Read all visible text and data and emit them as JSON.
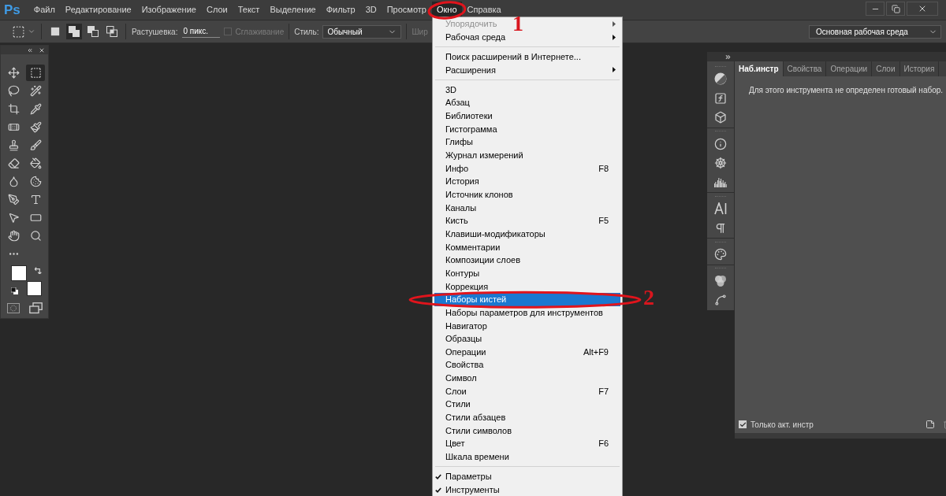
{
  "menu_bar": {
    "logo": "Ps",
    "items": [
      {
        "label": "Файл",
        "selected": false
      },
      {
        "label": "Редактирование",
        "selected": false
      },
      {
        "label": "Изображение",
        "selected": false
      },
      {
        "label": "Слои",
        "selected": false
      },
      {
        "label": "Текст",
        "selected": false
      },
      {
        "label": "Выделение",
        "selected": false
      },
      {
        "label": "Фильтр",
        "selected": false
      },
      {
        "label": "3D",
        "selected": false
      },
      {
        "label": "Просмотр",
        "selected": false
      },
      {
        "label": "Окно",
        "selected": true
      },
      {
        "label": "Справка",
        "selected": false
      }
    ]
  },
  "options_bar": {
    "selection_modes": [
      {
        "kind": "new",
        "selected": false
      },
      {
        "kind": "add",
        "selected": true
      },
      {
        "kind": "subtract",
        "selected": false
      },
      {
        "kind": "intersect",
        "selected": false
      }
    ],
    "feather": {
      "label": "Растушевка:",
      "value": "0 пикс."
    },
    "anti_alias": {
      "label": "Сглаживание",
      "checked": false,
      "disabled": true
    },
    "style": {
      "label": "Стиль:",
      "value": "Обычный"
    },
    "width": {
      "label": "Шир",
      "disabled": true
    },
    "workspace": {
      "value": "Основная рабочая среда"
    }
  },
  "toolbar": {
    "tools": [
      {
        "kind": "move",
        "selected": false
      },
      {
        "kind": "marquee",
        "selected": true
      },
      {
        "kind": "lasso",
        "selected": false
      },
      {
        "kind": "wand",
        "selected": false
      },
      {
        "kind": "crop",
        "selected": false
      },
      {
        "kind": "eyedropper",
        "selected": false
      },
      {
        "kind": "healing",
        "selected": false
      },
      {
        "kind": "brush",
        "selected": false
      },
      {
        "kind": "stamp",
        "selected": false
      },
      {
        "kind": "history_brush",
        "selected": false
      },
      {
        "kind": "eraser",
        "selected": false
      },
      {
        "kind": "bucket",
        "selected": false
      },
      {
        "kind": "blur",
        "selected": false
      },
      {
        "kind": "sponge",
        "selected": false
      },
      {
        "kind": "pen",
        "selected": false
      },
      {
        "kind": "type",
        "selected": false
      },
      {
        "kind": "path_select",
        "selected": false
      },
      {
        "kind": "shape",
        "selected": false
      },
      {
        "kind": "hand",
        "selected": false
      },
      {
        "kind": "zoom",
        "selected": false
      },
      {
        "kind": "more",
        "selected": false
      }
    ]
  },
  "window_menu": {
    "items": [
      {
        "kind": "submenu",
        "label": "Упорядочить",
        "disabled": true,
        "checked": false,
        "selected": false
      },
      {
        "kind": "submenu",
        "label": "Рабочая среда",
        "disabled": false,
        "checked": false,
        "selected": false
      },
      {
        "kind": "separator"
      },
      {
        "kind": "item",
        "label": "Поиск расширений в Интернете...",
        "disabled": false,
        "checked": false,
        "selected": false
      },
      {
        "kind": "submenu",
        "label": "Расширения",
        "disabled": false,
        "checked": false,
        "selected": false
      },
      {
        "kind": "separator"
      },
      {
        "kind": "item",
        "label": "3D",
        "disabled": false,
        "checked": false,
        "selected": false
      },
      {
        "kind": "item",
        "label": "Абзац",
        "disabled": false,
        "checked": false,
        "selected": false
      },
      {
        "kind": "item",
        "label": "Библиотеки",
        "disabled": false,
        "checked": false,
        "selected": false
      },
      {
        "kind": "item",
        "label": "Гистограмма",
        "disabled": false,
        "checked": false,
        "selected": false
      },
      {
        "kind": "item",
        "label": "Глифы",
        "disabled": false,
        "checked": false,
        "selected": false
      },
      {
        "kind": "item",
        "label": "Журнал измерений",
        "disabled": false,
        "checked": false,
        "selected": false
      },
      {
        "kind": "item",
        "label": "Инфо",
        "shortcut": "F8",
        "disabled": false,
        "checked": false,
        "selected": false
      },
      {
        "kind": "item",
        "label": "История",
        "disabled": false,
        "checked": false,
        "selected": false
      },
      {
        "kind": "item",
        "label": "Источник клонов",
        "disabled": false,
        "checked": false,
        "selected": false
      },
      {
        "kind": "item",
        "label": "Каналы",
        "disabled": false,
        "checked": false,
        "selected": false
      },
      {
        "kind": "item",
        "label": "Кисть",
        "shortcut": "F5",
        "disabled": false,
        "checked": false,
        "selected": false
      },
      {
        "kind": "item",
        "label": "Клавиши-модификаторы",
        "disabled": false,
        "checked": false,
        "selected": false
      },
      {
        "kind": "item",
        "label": "Комментарии",
        "disabled": false,
        "checked": false,
        "selected": false
      },
      {
        "kind": "item",
        "label": "Композиции слоев",
        "disabled": false,
        "checked": false,
        "selected": false
      },
      {
        "kind": "item",
        "label": "Контуры",
        "disabled": false,
        "checked": false,
        "selected": false
      },
      {
        "kind": "item",
        "label": "Коррекция",
        "disabled": false,
        "checked": false,
        "selected": false
      },
      {
        "kind": "item",
        "label": "Наборы кистей",
        "disabled": false,
        "checked": false,
        "selected": true
      },
      {
        "kind": "item",
        "label": "Наборы параметров для инструментов",
        "disabled": false,
        "checked": false,
        "selected": false
      },
      {
        "kind": "item",
        "label": "Навигатор",
        "disabled": false,
        "checked": false,
        "selected": false
      },
      {
        "kind": "item",
        "label": "Образцы",
        "disabled": false,
        "checked": false,
        "selected": false
      },
      {
        "kind": "item",
        "label": "Операции",
        "shortcut": "Alt+F9",
        "disabled": false,
        "checked": false,
        "selected": false
      },
      {
        "kind": "item",
        "label": "Свойства",
        "disabled": false,
        "checked": false,
        "selected": false
      },
      {
        "kind": "item",
        "label": "Символ",
        "disabled": false,
        "checked": false,
        "selected": false
      },
      {
        "kind": "item",
        "label": "Слои",
        "shortcut": "F7",
        "disabled": false,
        "checked": false,
        "selected": false
      },
      {
        "kind": "item",
        "label": "Стили",
        "disabled": false,
        "checked": false,
        "selected": false
      },
      {
        "kind": "item",
        "label": "Стили абзацев",
        "disabled": false,
        "checked": false,
        "selected": false
      },
      {
        "kind": "item",
        "label": "Стили символов",
        "disabled": false,
        "checked": false,
        "selected": false
      },
      {
        "kind": "item",
        "label": "Цвет",
        "shortcut": "F6",
        "disabled": false,
        "checked": false,
        "selected": false
      },
      {
        "kind": "item",
        "label": "Шкала времени",
        "disabled": false,
        "checked": false,
        "selected": false
      },
      {
        "kind": "separator"
      },
      {
        "kind": "item",
        "label": "Параметры",
        "disabled": false,
        "checked": true,
        "selected": false
      },
      {
        "kind": "item",
        "label": "Инструменты",
        "disabled": false,
        "checked": true,
        "selected": false
      }
    ]
  },
  "right_panel": {
    "tabs": [
      {
        "label": "Наб.инстр",
        "selected": true
      },
      {
        "label": "Свойства",
        "selected": false
      },
      {
        "label": "Операции",
        "selected": false
      },
      {
        "label": "Слои",
        "selected": false
      },
      {
        "label": "История",
        "selected": false
      }
    ],
    "message": "Для этого инструмента не определен готовый набор.",
    "only_active": {
      "label": "Только акт. инстр",
      "checked": true
    }
  },
  "annotations": [
    {
      "label": "1"
    },
    {
      "label": "2"
    }
  ]
}
